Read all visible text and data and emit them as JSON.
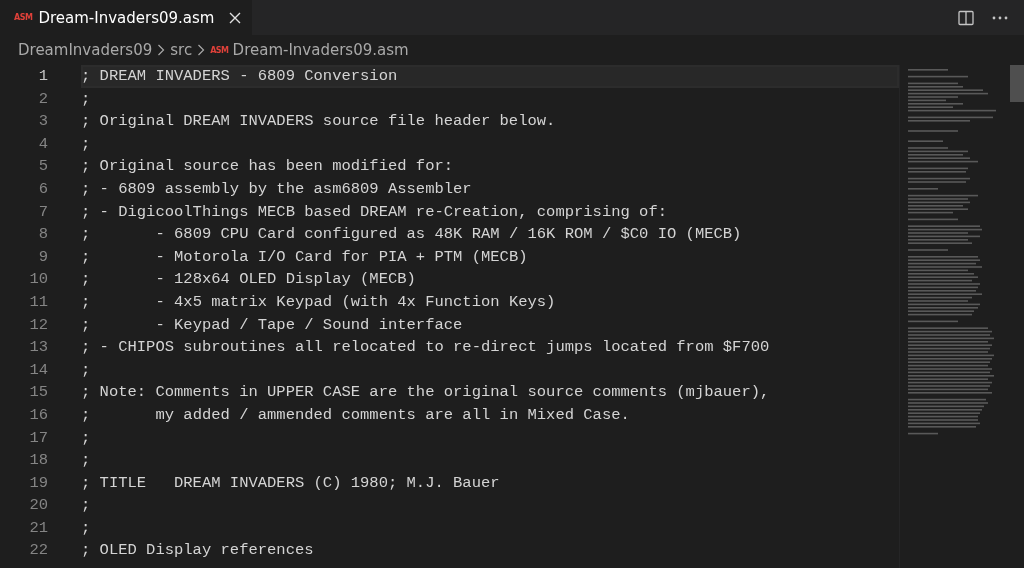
{
  "tabs": [
    {
      "icon_label": "ASM",
      "label": "Dream-Invaders09.asm",
      "selected": true
    }
  ],
  "breadcrumbs": [
    {
      "label": "DreamInvaders09"
    },
    {
      "label": "src"
    },
    {
      "icon_label": "ASM",
      "label": "Dream-Invaders09.asm"
    }
  ],
  "lines": [
    {
      "number": "1",
      "text": "; DREAM INVADERS - 6809 Conversion",
      "current": true
    },
    {
      "number": "2",
      "text": ";",
      "current": false
    },
    {
      "number": "3",
      "text": "; Original DREAM INVADERS source file header below.",
      "current": false
    },
    {
      "number": "4",
      "text": ";",
      "current": false
    },
    {
      "number": "5",
      "text": "; Original source has been modified for:",
      "current": false
    },
    {
      "number": "6",
      "text": "; - 6809 assembly by the asm6809 Assembler",
      "current": false
    },
    {
      "number": "7",
      "text": "; - DigicoolThings MECB based DREAM re-Creation, comprising of:",
      "current": false
    },
    {
      "number": "8",
      "text": ";\t- 6809 CPU Card configured as 48K RAM / 16K ROM / $C0 IO (MECB)",
      "current": false
    },
    {
      "number": "9",
      "text": ";\t- Motorola I/O Card for PIA + PTM (MECB)",
      "current": false
    },
    {
      "number": "10",
      "text": ";\t- 128x64 OLED Display (MECB)",
      "current": false
    },
    {
      "number": "11",
      "text": ";\t- 4x5 matrix Keypad (with 4x Function Keys)",
      "current": false
    },
    {
      "number": "12",
      "text": ";\t- Keypad / Tape / Sound interface",
      "current": false
    },
    {
      "number": "13",
      "text": "; - CHIPOS subroutines all relocated to re-direct jumps located from $F700",
      "current": false
    },
    {
      "number": "14",
      "text": ";",
      "current": false
    },
    {
      "number": "15",
      "text": "; Note: Comments in UPPER CASE are the original source comments (mjbauer),",
      "current": false
    },
    {
      "number": "16",
      "text": ";\tmy added / ammended comments are all in Mixed Case.",
      "current": false
    },
    {
      "number": "17",
      "text": ";",
      "current": false
    },
    {
      "number": "18",
      "text": ";",
      "current": false
    },
    {
      "number": "19",
      "text": "; TITLE   DREAM INVADERS (C) 1980; M.J. Bauer",
      "current": false
    },
    {
      "number": "20",
      "text": ";",
      "current": false
    },
    {
      "number": "21",
      "text": ";",
      "current": false
    },
    {
      "number": "22",
      "text": "; OLED Display references",
      "current": false
    }
  ]
}
